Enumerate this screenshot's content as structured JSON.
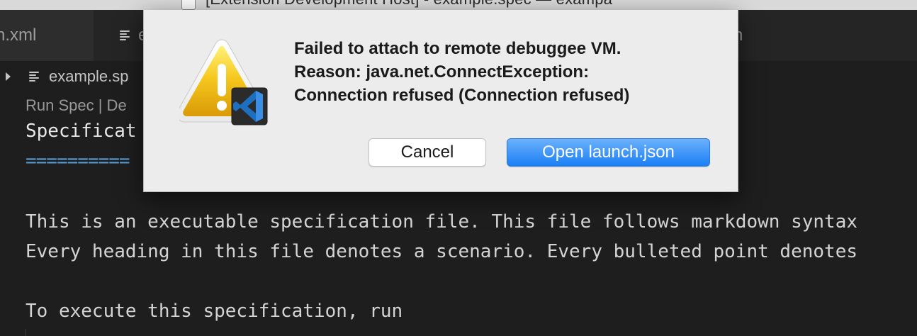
{
  "window": {
    "title": "[Extension Development Host] - example.spec — exampa"
  },
  "tabs": [
    {
      "label": "n.xml"
    },
    {
      "label": "e"
    },
    {
      "label": "n"
    }
  ],
  "breadcrumb": {
    "file": "example.sp"
  },
  "editor": {
    "codelens": "Run Spec | De",
    "lines": [
      "Specificat",
      "==========",
      "This is an executable specification file. This file follows markdown syntax",
      "Every heading in this file denotes a scenario. Every bulleted point denotes",
      "To execute this specification, run"
    ]
  },
  "dialog": {
    "message_lines": [
      "Failed to attach to remote debuggee VM.",
      "Reason: java.net.ConnectException:",
      "Connection refused (Connection refused)"
    ],
    "cancel_label": "Cancel",
    "primary_label": "Open launch.json",
    "icons": [
      "warning-triangle-icon",
      "vscode-logo-icon"
    ],
    "colors": {
      "primary_button": "#1b7ff5",
      "warning": "#f5c518"
    }
  }
}
